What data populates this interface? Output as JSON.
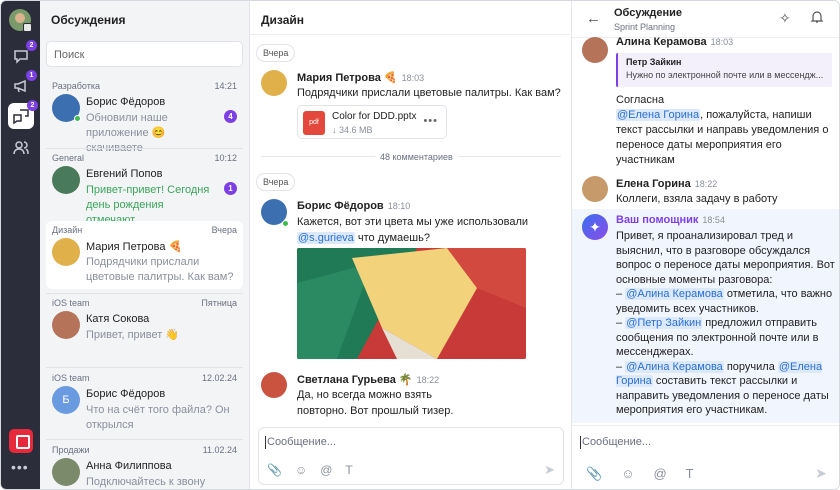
{
  "rail": {
    "badges": [
      "2",
      "1",
      "2"
    ]
  },
  "list": {
    "title": "Обсуждения",
    "search_placeholder": "Поиск",
    "items": [
      {
        "group": "Разработка",
        "date": "14:21",
        "name": "Борис Фёдоров",
        "preview": "Обновили наше приложение 😊 скачиваете",
        "unread": "4"
      },
      {
        "group": "General",
        "date": "10:12",
        "name": "Евгений Попов",
        "preview": "Привет-привет! Сегодня день рождения отмечают",
        "unread": "1"
      },
      {
        "group": "Дизайн",
        "date": "Вчера",
        "name": "Мария Петрова 🍕",
        "preview": "Подрядчики прислали цветовые палитры. Как вам?"
      },
      {
        "group": "iOS team",
        "date": "Пятница",
        "name": "Катя Сокова",
        "preview": "Привет, привет 👋"
      },
      {
        "group": "iOS team",
        "date": "12.02.24",
        "name": "Борис Фёдоров",
        "preview": "Что на счёт того файла? Он открылся",
        "initial": "Б"
      },
      {
        "group": "Продажи",
        "date": "11.02.24",
        "name": "Анна Филиппова",
        "preview": "Подключайтесь к звону"
      }
    ]
  },
  "mid": {
    "title": "Дизайн",
    "day1": "Вчера",
    "m1": {
      "name": "Мария Петрова 🍕",
      "time": "18:03",
      "text": "Подрядчики прислали цветовые палитры. Как вам?"
    },
    "file": {
      "ext": "pdf",
      "name": "Color for DDD.pptx",
      "size": "↓ 34.6 MB",
      "menu": "•••"
    },
    "comments": "48 комментариев",
    "day2": "Вчера",
    "m2": {
      "name": "Борис Фёдоров",
      "time": "18:10",
      "text_a": "Кажется, вот эти цвета мы уже использовали ",
      "mention": "@s.gurieva",
      "text_b": " что думаешь?"
    },
    "m3": {
      "name": "Светлана Гурьева 🌴",
      "time": "18:22",
      "text": "Да, но всегда можно взять повторно. Вот прошлый тизер."
    },
    "composer_placeholder": "Сообщение..."
  },
  "right": {
    "title": "Обсуждение",
    "subtitle": "Sprint Planning",
    "r1": {
      "name": "Алина Керамова",
      "time": "18:03"
    },
    "quote": {
      "name": "Петр Зайкин",
      "text": "Нужно по электронной почте или в мессендж..."
    },
    "r1_text_a": "Согласна",
    "r1_mention": "@Елена Горина",
    "r1_text_b": ", пожалуйста, напиши текст рассылки и направь уведомления о переносе даты мероприятия его участникам",
    "r2": {
      "name": "Елена Горина",
      "time": "18:22",
      "text": "Коллеги, взяла задачу в работу"
    },
    "ai": {
      "name": "Ваш помощник",
      "time": "18:54",
      "p1": "Привет, я проанализировал тред и выяснил, что в разговоре обсуждался вопрос о переносе даты мероприятия. Вот основные моменты разговора:",
      "b1_dash": "– ",
      "b1_mention": "@Алина Керамова",
      "b1_text": " отметила, что важно уведомить всех участников.",
      "b2_dash": "– ",
      "b2_mention": "@Петр Зайкин",
      "b2_text": " предложил отправить сообщения по электронной почте или в мессенджерах.",
      "b3_dash": "– ",
      "b3_mention": "@Алина Керамова",
      "b3_text_a": " поручила ",
      "b3_mention2": "@Елена Горина",
      "b3_text_b": " составить текст рассылки и направить уведомления о переносе даты мероприятия его участникам."
    },
    "composer_placeholder": "Сообщение..."
  }
}
